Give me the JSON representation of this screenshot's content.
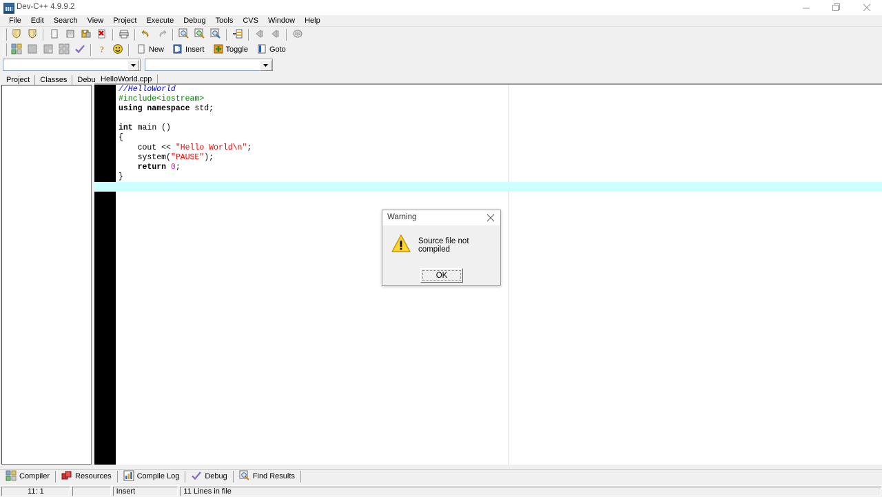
{
  "window": {
    "title": "Dev-C++ 4.9.9.2",
    "icon": "app-icon",
    "controls": [
      {
        "name": "minimize-button",
        "glyph": "minimize"
      },
      {
        "name": "restore-button",
        "glyph": "restore"
      },
      {
        "name": "close-button",
        "glyph": "close"
      }
    ]
  },
  "menubar": {
    "items": [
      "File",
      "Edit",
      "Search",
      "View",
      "Project",
      "Execute",
      "Debug",
      "Tools",
      "CVS",
      "Window",
      "Help"
    ]
  },
  "toolbar": {
    "row1": [
      {
        "name": "new-project-button",
        "icon": "shield-yellow-icon"
      },
      {
        "name": "open-project-button",
        "icon": "shield-open-icon"
      },
      {
        "sep": true
      },
      {
        "name": "new-file-button",
        "icon": "page-icon"
      },
      {
        "name": "open-file-button",
        "icon": "folder-open-icon"
      },
      {
        "name": "save-file-button",
        "icon": "floppy-disk-icon"
      },
      {
        "name": "close-file-button",
        "icon": "page-delete-icon"
      },
      {
        "sep": true
      },
      {
        "name": "print-button",
        "icon": "printer-icon"
      },
      {
        "sep": true
      },
      {
        "name": "undo-button",
        "icon": "undo-arrow-icon"
      },
      {
        "name": "redo-button",
        "icon": "redo-arrow-icon"
      },
      {
        "sep": true
      },
      {
        "name": "find-button",
        "icon": "magnifier-icon"
      },
      {
        "name": "find-next-button",
        "icon": "magnifier-green-icon"
      },
      {
        "name": "replace-button",
        "icon": "magnifier-replace-icon"
      },
      {
        "sep": true
      },
      {
        "name": "goto-line-button",
        "icon": "goto-line-icon"
      },
      {
        "sep": true
      },
      {
        "name": "nav-back-button",
        "icon": "arrow-left-icon"
      },
      {
        "name": "nav-forward-button",
        "icon": "arrow-left-gray-icon"
      },
      {
        "sep": true
      },
      {
        "name": "profile-button",
        "icon": "oval-icon"
      }
    ],
    "row2": [
      {
        "name": "compile-button",
        "icon": "grid-blocks-icon"
      },
      {
        "name": "run-button",
        "icon": "block-icon"
      },
      {
        "name": "compile-run-button",
        "icon": "block2-icon"
      },
      {
        "name": "rebuild-all-button",
        "icon": "grid-blocks2-icon"
      },
      {
        "name": "syntax-check-button",
        "icon": "checkmark-icon"
      },
      {
        "sep": true
      },
      {
        "name": "help-button",
        "icon": "question-mark-icon"
      },
      {
        "name": "about-button",
        "icon": "smiley-icon"
      },
      {
        "sep": true
      }
    ],
    "row2_text": [
      {
        "name": "new-bookmark-button",
        "label": "New",
        "icon": "page-icon"
      },
      {
        "name": "insert-button",
        "label": "Insert",
        "icon": "insert-icon"
      },
      {
        "name": "toggle-button",
        "label": "Toggle",
        "icon": "toggle-plus-icon"
      },
      {
        "name": "goto-button",
        "label": "Goto",
        "icon": "goto-book-icon"
      }
    ]
  },
  "combos": {
    "class_browser_value": "",
    "member_browser_value": ""
  },
  "left_panel": {
    "tabs": [
      {
        "name": "tab-project",
        "label": "Project",
        "selected": true
      },
      {
        "name": "tab-classes",
        "label": "Classes",
        "selected": false
      },
      {
        "name": "tab-debug",
        "label": "Debug",
        "selected": false
      }
    ],
    "tree_items": []
  },
  "editor": {
    "tabs": [
      {
        "name": "editor-tab-helloworld",
        "label": "HelloWorld.cpp",
        "selected": true
      }
    ],
    "current_line_index": 10,
    "lines": [
      [
        {
          "t": "//HelloWorld",
          "c": "c-com"
        }
      ],
      [
        {
          "t": "#include<iostream>",
          "c": "c-pre"
        }
      ],
      [
        {
          "t": "using namespace",
          "c": "c-key"
        },
        {
          "t": " std;",
          "c": "c-pln"
        }
      ],
      [],
      [
        {
          "t": "int",
          "c": "c-key"
        },
        {
          "t": " main ()",
          "c": "c-pln"
        }
      ],
      [
        {
          "t": "{",
          "c": "c-pln"
        }
      ],
      [
        {
          "t": "    cout << ",
          "c": "c-pln"
        },
        {
          "t": "\"Hello World\\n\"",
          "c": "c-str"
        },
        {
          "t": ";",
          "c": "c-pln"
        }
      ],
      [
        {
          "t": "    system(",
          "c": "c-pln"
        },
        {
          "t": "\"PAUSE\"",
          "c": "c-str"
        },
        {
          "t": ");",
          "c": "c-pln"
        }
      ],
      [
        {
          "t": "    ",
          "c": "c-pln"
        },
        {
          "t": "return",
          "c": "c-key"
        },
        {
          "t": " ",
          "c": "c-pln"
        },
        {
          "t": "0",
          "c": "c-num"
        },
        {
          "t": ";",
          "c": "c-pln"
        }
      ],
      [
        {
          "t": "}",
          "c": "c-pln"
        }
      ],
      []
    ]
  },
  "bottom_tabs": [
    {
      "name": "bottom-tab-compiler",
      "label": "Compiler",
      "icon": "grid-blocks-icon"
    },
    {
      "name": "bottom-tab-resources",
      "label": "Resources",
      "icon": "cubes-red-icon"
    },
    {
      "name": "bottom-tab-compile-log",
      "label": "Compile Log",
      "icon": "bar-chart-icon"
    },
    {
      "name": "bottom-tab-debug",
      "label": "Debug",
      "icon": "checkmark-icon"
    },
    {
      "name": "bottom-tab-find-results",
      "label": "Find Results",
      "icon": "magnifier-icon"
    }
  ],
  "statusbar": {
    "cursor": "11: 1",
    "blank": "",
    "mode": "Insert",
    "lines": "11 Lines in file"
  },
  "dialog": {
    "title": "Warning",
    "message": "Source file not compiled",
    "icon": "warning-triangle-icon",
    "ok_label": "OK",
    "close_glyph": "close"
  },
  "colors": {
    "face": "#f0f0f0",
    "current_line": "#ccffff",
    "comment": "#0000ff",
    "preprocessor": "#008000",
    "string": "#ff0000",
    "number": "#ff00ff",
    "warning_yellow": "#ffcc00"
  }
}
